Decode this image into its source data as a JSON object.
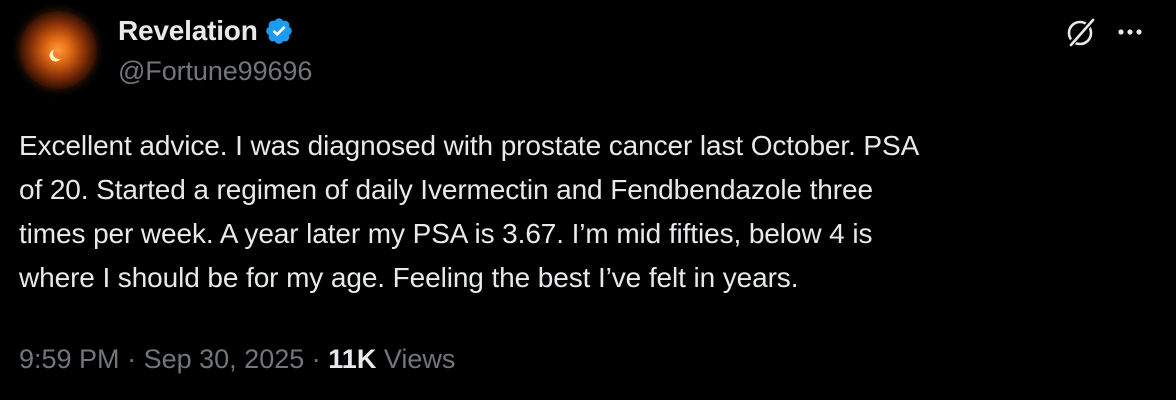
{
  "author": {
    "display_name": "Revelation",
    "handle": "@Fortune99696",
    "verified": true,
    "verified_color": "#1d9bf0"
  },
  "icons": {
    "verified": "verified-badge-icon",
    "grok": "grok-icon",
    "more": "more-options-icon"
  },
  "tweet": {
    "text": "Excellent advice. I was diagnosed with prostate cancer last October. PSA\nof 20. Started a regimen of daily Ivermectin and Fendbendazole three\ntimes per week. A year later my PSA is 3.67. I’m mid fifties, below 4 is\nwhere I should be for my age. Feeling the best I’ve felt in years."
  },
  "meta": {
    "time": "9:59 PM",
    "separator": "·",
    "date": "Sep 30, 2025",
    "views_count": "11K",
    "views_label": "Views"
  },
  "colors": {
    "background": "#000000",
    "primary_text": "#e7e9ea",
    "secondary_text": "#71767b"
  }
}
